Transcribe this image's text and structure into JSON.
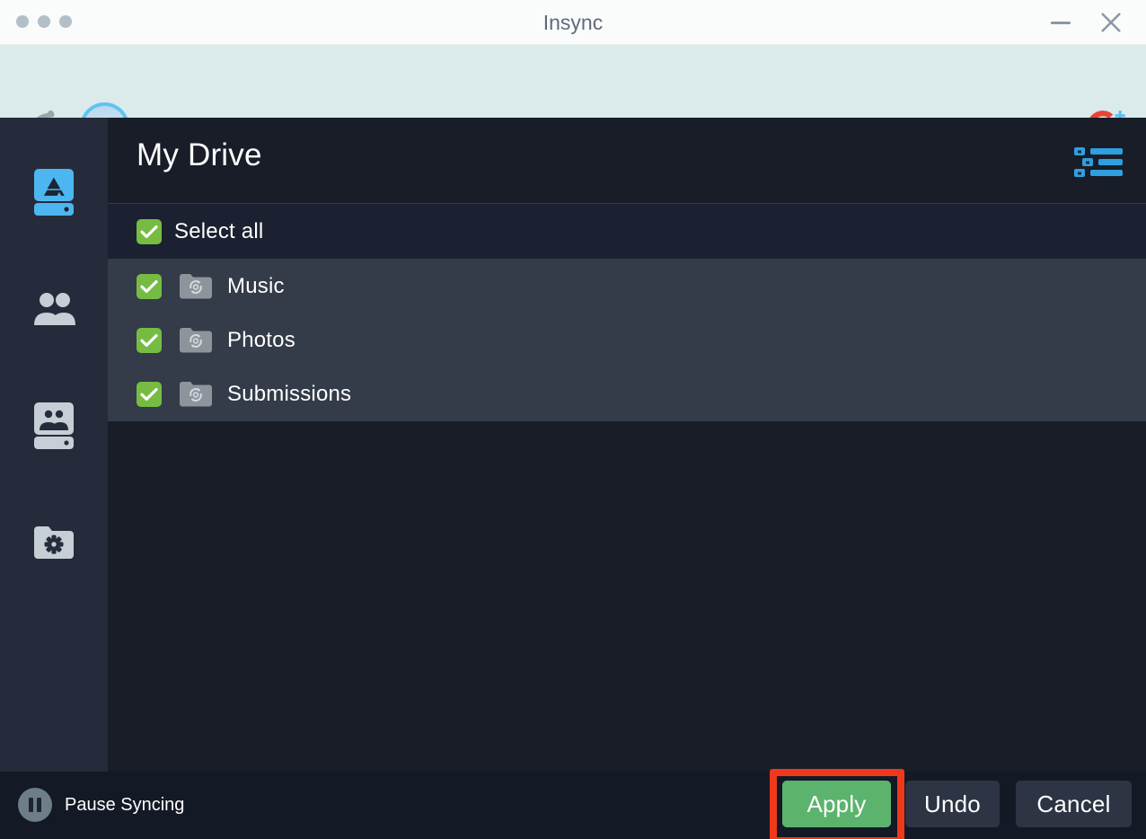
{
  "window": {
    "title": "Insync",
    "traffic_dots": [
      "close-dot",
      "minimize-dot",
      "zoom-dot"
    ],
    "minimize_label": "Minimize",
    "close_label": "Close"
  },
  "account_bar": {
    "app_logo": "insync-logo",
    "avatar": "account-avatar",
    "add_account_icon": "google-plus-icon",
    "background_color": "#dbeaea"
  },
  "sidebar": {
    "background_color": "#262b3b",
    "items": [
      {
        "id": "my-drive",
        "icon": "google-drive-icon",
        "active": true
      },
      {
        "id": "shared-with-me",
        "icon": "people-icon",
        "active": false
      },
      {
        "id": "shared-drives",
        "icon": "shared-drive-icon",
        "active": false
      },
      {
        "id": "settings",
        "icon": "folder-gear-icon",
        "active": false
      }
    ]
  },
  "main": {
    "title": "My Drive",
    "view_toggle_icon": "list-view-icon",
    "select_all": {
      "label": "Select all",
      "checked": true
    },
    "folders": [
      {
        "name": "Music",
        "checked": true,
        "icon": "sync-folder-icon"
      },
      {
        "name": "Photos",
        "checked": true,
        "icon": "sync-folder-icon"
      },
      {
        "name": "Submissions",
        "checked": true,
        "icon": "sync-folder-icon"
      }
    ]
  },
  "bottom_bar": {
    "pause_label": "Pause Syncing",
    "pause_icon": "pause-icon",
    "buttons": {
      "apply": "Apply",
      "undo": "Undo",
      "cancel": "Cancel"
    }
  },
  "colors": {
    "accent_green": "#5cb36d",
    "checkbox_green": "#76bc43",
    "highlight_red": "#f0381c",
    "drive_blue": "#4db6f0",
    "content_bg": "#181d28",
    "row_bg": "#343b49",
    "select_all_bg": "#1b2130",
    "bottom_bar_bg": "#141a25"
  },
  "annotation": {
    "highlighted_element": "apply-button"
  }
}
